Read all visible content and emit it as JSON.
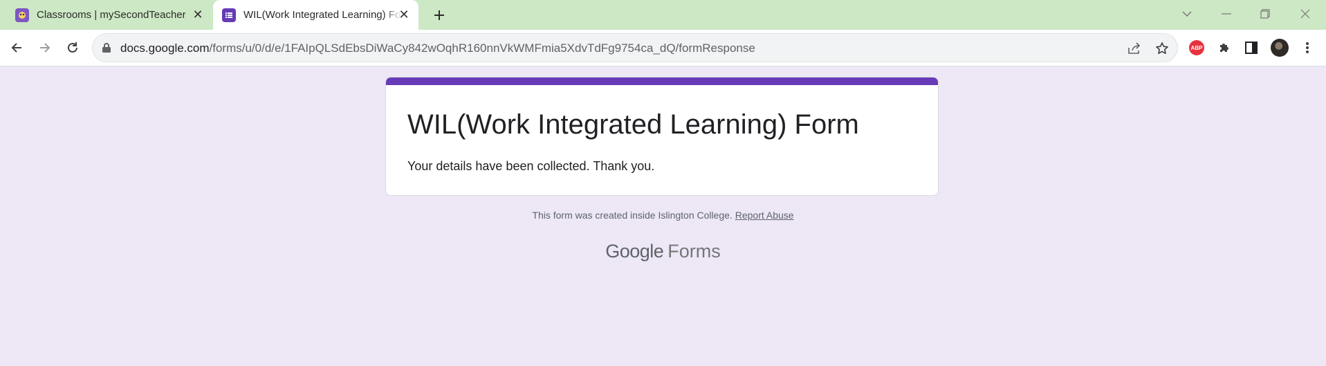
{
  "tabs": [
    {
      "title": "Classrooms | mySecondTeacher"
    },
    {
      "title": "WIL(Work Integrated Learning) Form"
    }
  ],
  "address_bar": {
    "host": "docs.google.com",
    "path": "/forms/u/0/d/e/1FAIpQLSdEbsDiWaCy842wOqhR160nnVkWMFmia5XdvTdFg9754ca_dQ/formResponse"
  },
  "extensions": {
    "abp_label": "ABP"
  },
  "form": {
    "title": "WIL(Work Integrated Learning) Form",
    "confirmation": "Your details have been collected. Thank you."
  },
  "footer": {
    "note": "This form was created inside Islington College.",
    "report_link": "Report Abuse"
  },
  "logo": {
    "google": "Google",
    "forms": "Forms"
  },
  "colors": {
    "accent": "#673ab7",
    "page_bg": "#ede7f6",
    "tabstrip_bg": "#cde8c4"
  }
}
